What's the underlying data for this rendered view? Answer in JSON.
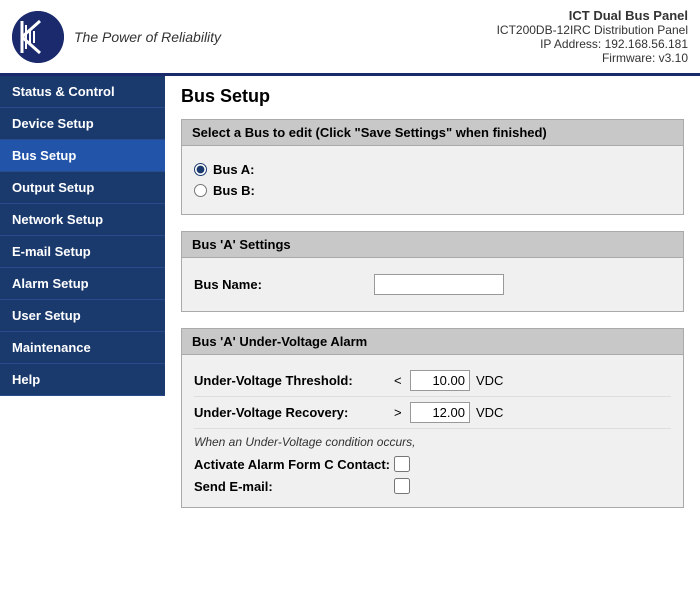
{
  "header": {
    "tagline": "The Power of Reliability",
    "info": {
      "title": "ICT Dual Bus Panel",
      "model": "ICT200DB-12IRC Distribution Panel",
      "ip": "IP Address: 192.168.56.181",
      "firmware": "Firmware: v3.10"
    }
  },
  "sidebar": {
    "items": [
      {
        "id": "status-control",
        "label": "Status & Control"
      },
      {
        "id": "device-setup",
        "label": "Device Setup"
      },
      {
        "id": "bus-setup",
        "label": "Bus Setup"
      },
      {
        "id": "output-setup",
        "label": "Output Setup"
      },
      {
        "id": "network-setup",
        "label": "Network Setup"
      },
      {
        "id": "email-setup",
        "label": "E-mail Setup"
      },
      {
        "id": "alarm-setup",
        "label": "Alarm Setup"
      },
      {
        "id": "user-setup",
        "label": "User Setup"
      },
      {
        "id": "maintenance",
        "label": "Maintenance"
      },
      {
        "id": "help",
        "label": "Help"
      }
    ]
  },
  "content": {
    "page_title": "Bus Setup",
    "select_bus": {
      "section_title": "Select a Bus to edit",
      "hint": "  (Click \"Save Settings\" when finished)",
      "options": [
        {
          "id": "bus-a",
          "label": "Bus A:",
          "checked": true
        },
        {
          "id": "bus-b",
          "label": "Bus B:",
          "checked": false
        }
      ]
    },
    "bus_settings": {
      "section_title": "Bus 'A' Settings",
      "fields": [
        {
          "label": "Bus Name:",
          "value": "",
          "placeholder": ""
        }
      ]
    },
    "under_voltage": {
      "section_title": "Bus 'A' Under-Voltage Alarm",
      "threshold_label": "Under-Voltage Threshold:",
      "threshold_sym": "<",
      "threshold_value": "10.00",
      "threshold_unit": "VDC",
      "recovery_label": "Under-Voltage Recovery:",
      "recovery_sym": ">",
      "recovery_value": "12.00",
      "recovery_unit": "VDC",
      "note": "When an Under-Voltage condition occurs,",
      "alarm_label": "Activate Alarm Form C Contact:",
      "email_label": "Send E-mail:"
    }
  }
}
